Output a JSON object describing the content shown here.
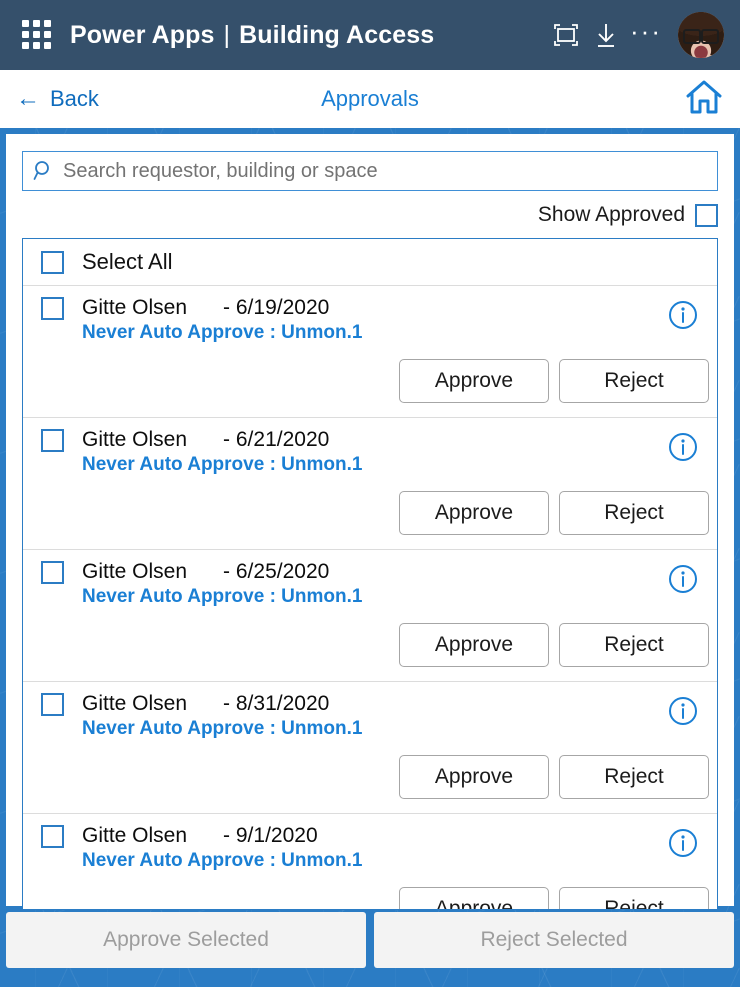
{
  "brandbar": {
    "waffle_label": "App launcher",
    "app_name": "Power Apps",
    "separator": "|",
    "page_name": "Building Access",
    "icons": {
      "fullscreen": "fullscreen-icon",
      "download": "download-icon",
      "more": "···"
    },
    "avatar_alt": "User avatar"
  },
  "subnav": {
    "back_arrow": "←",
    "back_label": "Back",
    "title": "Approvals",
    "home_icon": "home-icon"
  },
  "search": {
    "placeholder": "Search requestor, building or space",
    "value": "",
    "icon": "search-icon"
  },
  "filters": {
    "show_approved_label": "Show Approved",
    "show_approved_checked": false
  },
  "list": {
    "select_all_label": "Select All",
    "select_all_checked": false,
    "info_icon": "info-icon",
    "approve_label": "Approve",
    "reject_label": "Reject",
    "scroll_chevron": "⌄",
    "items": [
      {
        "checked": false,
        "name": "Gitte Olsen",
        "date": "- 6/19/2020",
        "detail": "Never Auto Approve : Unmon.1"
      },
      {
        "checked": false,
        "name": "Gitte Olsen",
        "date": "- 6/21/2020",
        "detail": "Never Auto Approve : Unmon.1"
      },
      {
        "checked": false,
        "name": "Gitte Olsen",
        "date": "- 6/25/2020",
        "detail": "Never Auto Approve : Unmon.1"
      },
      {
        "checked": false,
        "name": "Gitte Olsen",
        "date": "- 8/31/2020",
        "detail": "Never Auto Approve : Unmon.1"
      },
      {
        "checked": false,
        "name": "Gitte Olsen",
        "date": "- 9/1/2020",
        "detail": "Never Auto Approve : Unmon.1"
      }
    ]
  },
  "footer": {
    "approve_selected_label": "Approve Selected",
    "reject_selected_label": "Reject Selected",
    "enabled": false
  },
  "colors": {
    "brand_bar": "#35506b",
    "accent_blue": "#2b7cc4",
    "link_blue": "#1a7fd4",
    "panel_white": "#ffffff",
    "disabled_text": "#9d9d9d"
  }
}
